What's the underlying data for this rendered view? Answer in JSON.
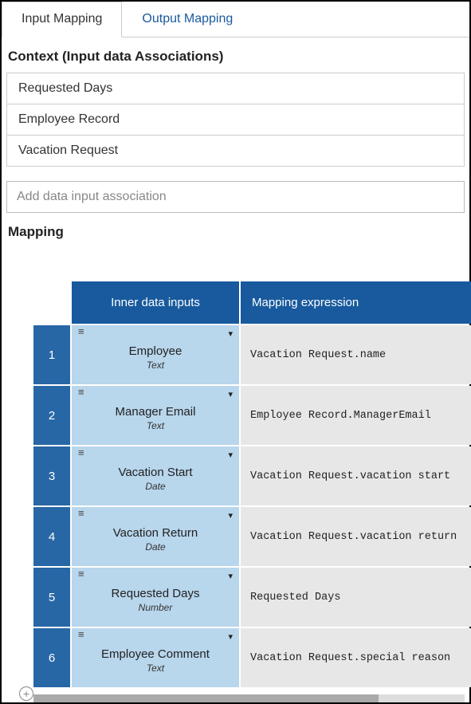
{
  "tabs": {
    "input": "Input Mapping",
    "output": "Output Mapping"
  },
  "context": {
    "header": "Context (Input data Associations)",
    "items": [
      "Requested Days",
      "Employee Record",
      "Vacation Request"
    ]
  },
  "add_input_placeholder": "Add data input association",
  "mapping": {
    "header": "Mapping",
    "col_inner": "Inner data inputs",
    "col_expr": "Mapping expression",
    "rows": [
      {
        "num": "1",
        "name": "Employee",
        "type": "Text",
        "expr": "Vacation Request.name"
      },
      {
        "num": "2",
        "name": "Manager Email",
        "type": "Text",
        "expr": "Employee Record.ManagerEmail"
      },
      {
        "num": "3",
        "name": "Vacation Start",
        "type": "Date",
        "expr": "Vacation Request.vacation start"
      },
      {
        "num": "4",
        "name": "Vacation Return",
        "type": "Date",
        "expr": "Vacation Request.vacation return"
      },
      {
        "num": "5",
        "name": "Requested Days",
        "type": "Number",
        "expr": "Requested Days"
      },
      {
        "num": "6",
        "name": "Employee Comment",
        "type": "Text",
        "expr": "Vacation Request.special reason"
      }
    ]
  }
}
